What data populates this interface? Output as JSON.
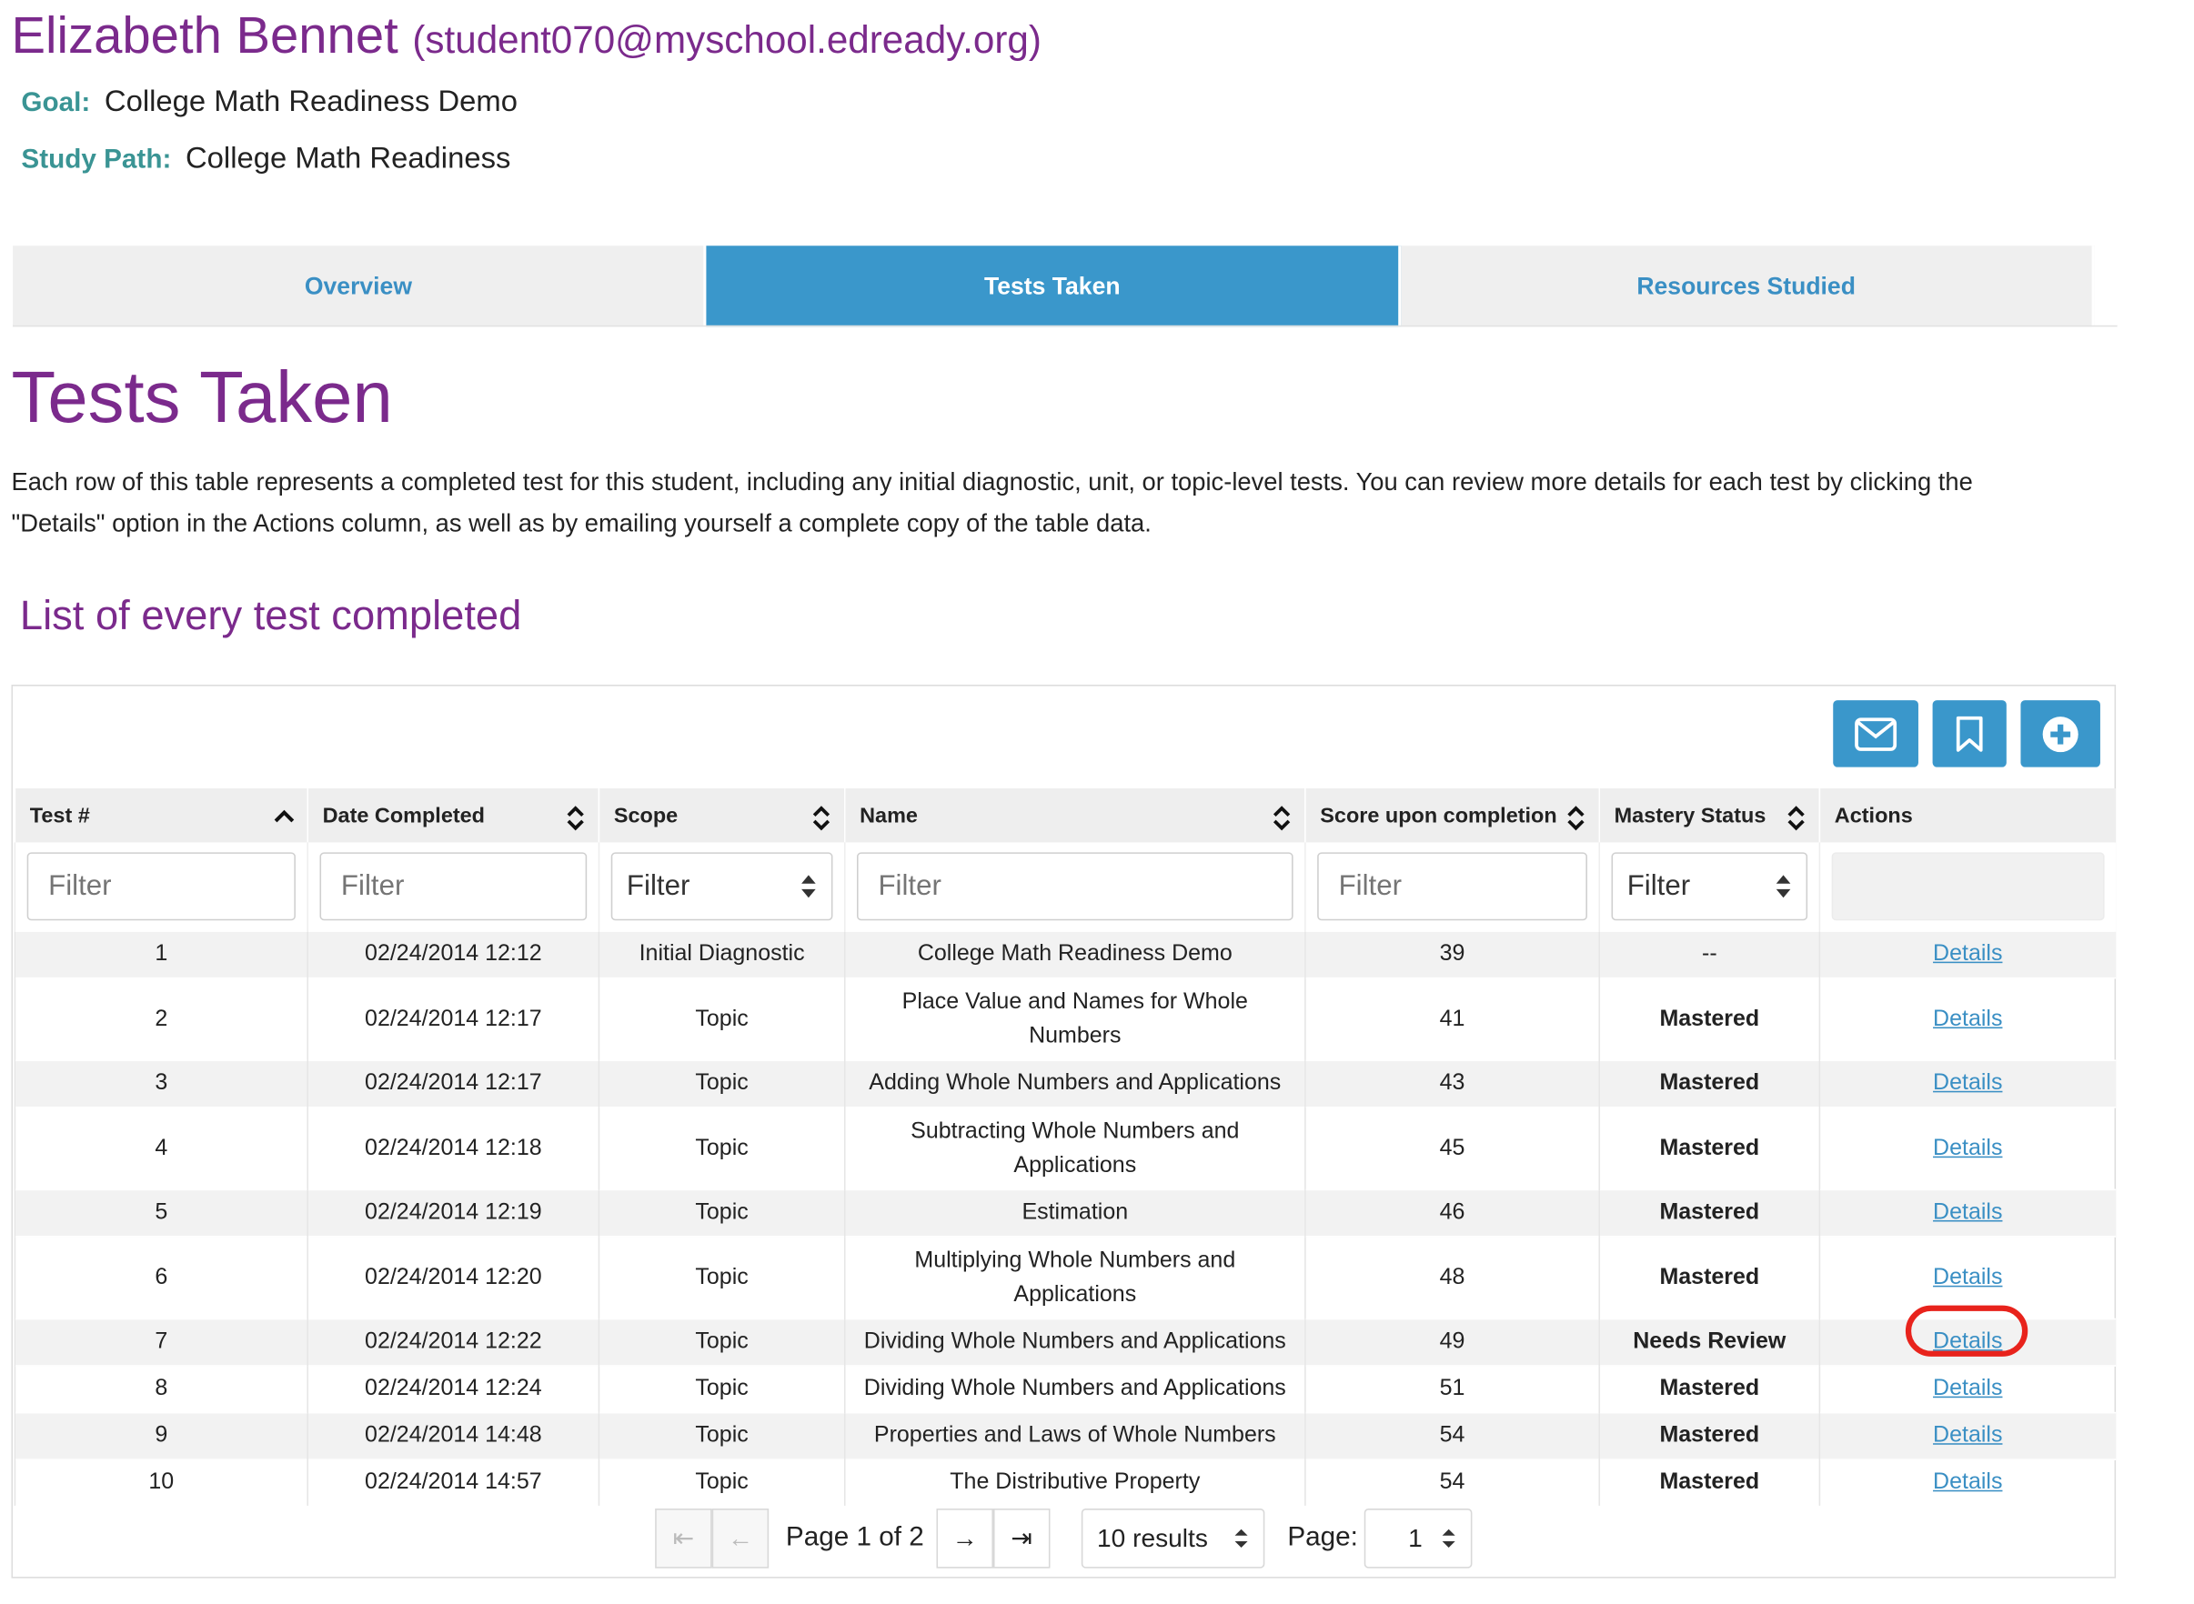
{
  "student": {
    "name": "Elizabeth Bennet",
    "email": "(student070@myschool.edready.org)",
    "goal_label": "Goal:",
    "goal_value": "College Math Readiness Demo",
    "path_label": "Study Path:",
    "path_value": "College Math Readiness"
  },
  "tabs": [
    {
      "label": "Overview",
      "active": false
    },
    {
      "label": "Tests Taken",
      "active": true
    },
    {
      "label": "Resources Studied",
      "active": false
    }
  ],
  "page": {
    "title": "Tests Taken",
    "description": "Each row of this table represents a completed test for this student, including any initial diagnostic, unit, or topic-level tests. You can review more details for each test by clicking the \"Details\" option in the Actions column, as well as by emailing yourself a complete copy of the table data.",
    "section_title": "List of every test completed"
  },
  "toolbar": {
    "icons": [
      "email-icon",
      "bookmark-icon",
      "add-circle-icon"
    ],
    "accent": "#3a97cb"
  },
  "table": {
    "headers": [
      "Test #",
      "Date Completed",
      "Scope",
      "Name",
      "Score upon completion",
      "Mastery Status",
      "Actions"
    ],
    "filters": {
      "test_placeholder": "Filter",
      "date_placeholder": "Filter",
      "scope_value": "Filter",
      "name_placeholder": "Filter",
      "score_placeholder": "Filter",
      "mastery_value": "Filter"
    },
    "rows": [
      {
        "num": "1",
        "date": "02/24/2014 12:12",
        "scope": "Initial Diagnostic",
        "name": "College Math Readiness Demo",
        "score": "39",
        "mastery": "--",
        "action": "Details"
      },
      {
        "num": "2",
        "date": "02/24/2014 12:17",
        "scope": "Topic",
        "name": "Place Value and Names for Whole Numbers",
        "score": "41",
        "mastery": "Mastered",
        "action": "Details"
      },
      {
        "num": "3",
        "date": "02/24/2014 12:17",
        "scope": "Topic",
        "name": "Adding Whole Numbers and Applications",
        "score": "43",
        "mastery": "Mastered",
        "action": "Details"
      },
      {
        "num": "4",
        "date": "02/24/2014 12:18",
        "scope": "Topic",
        "name": "Subtracting Whole Numbers and Applications",
        "score": "45",
        "mastery": "Mastered",
        "action": "Details"
      },
      {
        "num": "5",
        "date": "02/24/2014 12:19",
        "scope": "Topic",
        "name": "Estimation",
        "score": "46",
        "mastery": "Mastered",
        "action": "Details"
      },
      {
        "num": "6",
        "date": "02/24/2014 12:20",
        "scope": "Topic",
        "name": "Multiplying Whole Numbers and Applications",
        "score": "48",
        "mastery": "Mastered",
        "action": "Details"
      },
      {
        "num": "7",
        "date": "02/24/2014 12:22",
        "scope": "Topic",
        "name": "Dividing Whole Numbers and Applications",
        "score": "49",
        "mastery": "Needs Review",
        "action": "Details"
      },
      {
        "num": "8",
        "date": "02/24/2014 12:24",
        "scope": "Topic",
        "name": "Dividing Whole Numbers and Applications",
        "score": "51",
        "mastery": "Mastered",
        "action": "Details"
      },
      {
        "num": "9",
        "date": "02/24/2014 14:48",
        "scope": "Topic",
        "name": "Properties and Laws of Whole Numbers",
        "score": "54",
        "mastery": "Mastered",
        "action": "Details"
      },
      {
        "num": "10",
        "date": "02/24/2014 14:57",
        "scope": "Topic",
        "name": "The Distributive Property",
        "score": "54",
        "mastery": "Mastered",
        "action": "Details"
      }
    ]
  },
  "pagination": {
    "page_text": "Page 1 of 2",
    "results_value": "10 results",
    "page_label": "Page:",
    "page_value": "1"
  },
  "colors": {
    "brand_purple": "#7b2a8c",
    "label_teal": "#3a9494",
    "mastered": "#6cc6a8",
    "needs_review": "#f5b23d",
    "highlight": "#e8231c"
  }
}
